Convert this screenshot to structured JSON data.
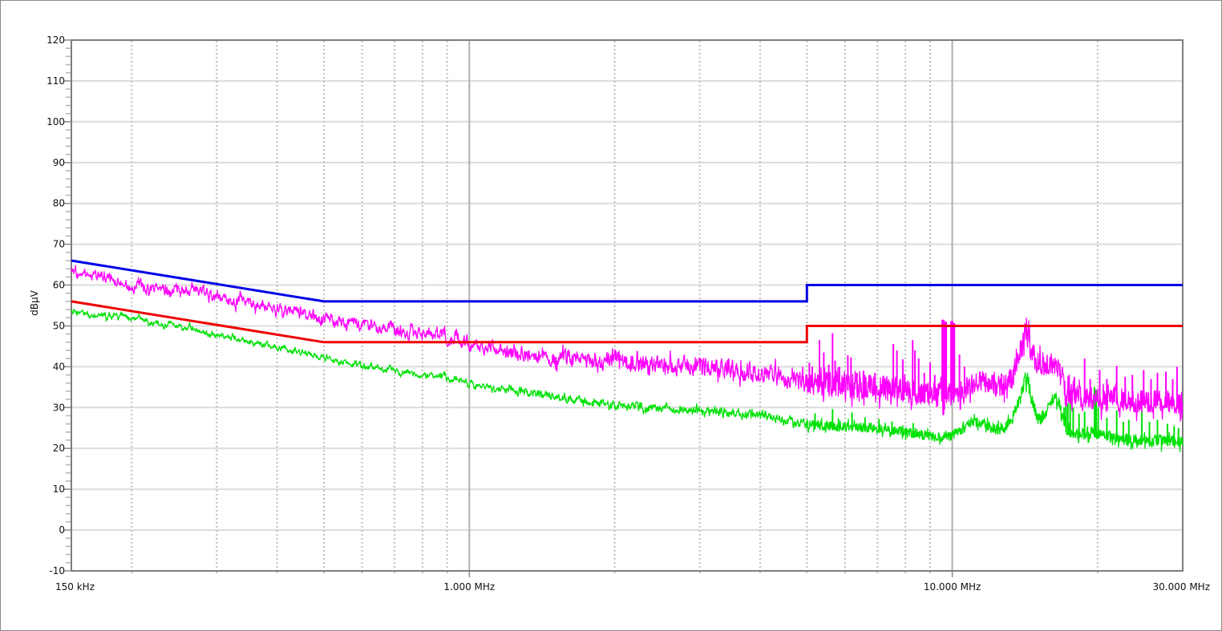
{
  "window": {
    "background": "#ffffff",
    "border_color": "#8c8c8c"
  },
  "chart_data": {
    "type": "line",
    "title": "",
    "plot": {
      "frame_color": "#7d7d7d",
      "h_grid_color": "#dcdcdc",
      "v_major_grid_color": "#b0b0b0",
      "v_minor_grid_color": "#bdbdbd",
      "tick_color": "#8a8a8a",
      "minor_tick_color": "#b8b8b8"
    },
    "y_axis": {
      "label": "dBµV",
      "min": -10,
      "max": 120,
      "major_step": 10,
      "minor_step": 2,
      "tick_labels": [
        "120",
        "110",
        "100",
        "90",
        "80",
        "70",
        "60",
        "50",
        "40",
        "30",
        "20",
        "10",
        "0",
        "-10"
      ]
    },
    "x_axis": {
      "scale": "log",
      "unit": "MHz",
      "min_mhz": 0.15,
      "max_mhz": 30,
      "ticks": [
        {
          "f": 0.15,
          "label": "150 kHz"
        },
        {
          "f": 1,
          "label": "1.000 MHz"
        },
        {
          "f": 10,
          "label": "10.000 MHz"
        },
        {
          "f": 30,
          "label": "30.000 MHz"
        }
      ],
      "minor_gridlines_mhz": [
        0.2,
        0.3,
        0.4,
        0.5,
        0.6,
        0.7,
        0.8,
        0.9,
        2,
        3,
        4,
        5,
        6,
        7,
        8,
        9,
        20
      ]
    },
    "series": [
      {
        "name": "trace-green-average",
        "color": "#00e106",
        "type": "noisy",
        "width": 1.3,
        "anchors": [
          [
            0.15,
            53.4
          ],
          [
            0.162,
            52.7
          ],
          [
            0.178,
            52.2
          ],
          [
            0.19,
            52.3
          ],
          [
            0.2,
            51.8
          ],
          [
            0.215,
            51.2
          ],
          [
            0.235,
            50.4
          ],
          [
            0.255,
            49.7
          ],
          [
            0.28,
            48.7
          ],
          [
            0.31,
            47.5
          ],
          [
            0.34,
            46.3
          ],
          [
            0.37,
            45.4
          ],
          [
            0.4,
            44.7
          ],
          [
            0.44,
            43.7
          ],
          [
            0.48,
            42.7
          ],
          [
            0.52,
            41.9
          ],
          [
            0.57,
            40.9
          ],
          [
            0.62,
            40.0
          ],
          [
            0.68,
            39.3
          ],
          [
            0.74,
            38.7
          ],
          [
            0.8,
            37.8
          ],
          [
            0.85,
            37.3
          ],
          [
            0.88,
            37.8
          ],
          [
            0.92,
            36.9
          ],
          [
            1.0,
            35.9
          ],
          [
            1.1,
            34.9
          ],
          [
            1.25,
            34.0
          ],
          [
            1.4,
            33.2
          ],
          [
            1.6,
            32.2
          ],
          [
            1.8,
            31.2
          ],
          [
            2.0,
            30.6
          ],
          [
            2.3,
            30.0
          ],
          [
            2.7,
            29.5
          ],
          [
            3.1,
            29.1
          ],
          [
            3.6,
            28.6
          ],
          [
            4.0,
            28.2
          ],
          [
            4.3,
            27.6
          ],
          [
            4.7,
            26.4
          ],
          [
            5.0,
            25.9
          ],
          [
            5.5,
            25.5
          ],
          [
            6.0,
            25.3
          ],
          [
            6.6,
            25.1
          ],
          [
            7.2,
            24.8
          ],
          [
            7.8,
            24.2
          ],
          [
            8.4,
            23.5
          ],
          [
            9.0,
            23.0
          ],
          [
            9.5,
            22.8
          ],
          [
            10.0,
            23.4
          ],
          [
            10.5,
            24.9
          ],
          [
            11.0,
            26.3
          ],
          [
            11.3,
            26.6
          ],
          [
            11.7,
            25.9
          ],
          [
            12.1,
            25.0
          ],
          [
            12.5,
            24.7
          ],
          [
            12.9,
            25.4
          ],
          [
            13.3,
            27.3
          ],
          [
            13.7,
            30.8
          ],
          [
            14.0,
            35.0
          ],
          [
            14.15,
            37.3
          ],
          [
            14.35,
            35.9
          ],
          [
            14.6,
            32.2
          ],
          [
            14.9,
            28.7
          ],
          [
            15.2,
            27.3
          ],
          [
            15.6,
            28.5
          ],
          [
            16.0,
            31.2
          ],
          [
            16.3,
            32.7
          ],
          [
            16.6,
            31.3
          ],
          [
            16.9,
            28.2
          ],
          [
            17.2,
            25.0
          ],
          [
            17.6,
            23.7
          ],
          [
            18.2,
            23.4
          ],
          [
            18.9,
            24.0
          ],
          [
            19.6,
            23.8
          ],
          [
            20.5,
            23.1
          ],
          [
            21.5,
            22.7
          ],
          [
            23,
            22.3
          ],
          [
            25,
            22.0
          ],
          [
            27,
            21.8
          ],
          [
            29,
            21.6
          ],
          [
            30,
            21.5
          ]
        ],
        "band": [
          [
            0.15,
            0.9
          ],
          [
            1,
            1.0
          ],
          [
            3,
            1.1
          ],
          [
            4.8,
            1.2
          ],
          [
            9,
            1.2
          ],
          [
            11,
            1.3
          ],
          [
            13,
            1.4
          ],
          [
            14.1,
            1.8
          ],
          [
            16,
            1.5
          ],
          [
            17.5,
            1.5
          ],
          [
            30,
            1.5
          ]
        ],
        "spikes": [
          [
            5.2,
            28.6
          ],
          [
            5.65,
            29.6
          ],
          [
            6.2,
            28.8
          ],
          [
            6.6,
            27.6
          ],
          [
            7.05,
            27.2
          ],
          [
            7.5,
            26.6
          ],
          [
            8.3,
            26.2
          ],
          [
            17.05,
            30
          ],
          [
            17.2,
            32
          ],
          [
            17.35,
            31
          ],
          [
            17.55,
            32.5
          ],
          [
            17.8,
            30
          ],
          [
            18.3,
            28.5
          ],
          [
            18.8,
            29
          ],
          [
            19.7,
            35
          ],
          [
            19.85,
            34.3
          ],
          [
            20.05,
            30
          ],
          [
            20.9,
            27.5
          ],
          [
            21.9,
            29.3
          ],
          [
            22.6,
            26.5
          ],
          [
            23.2,
            27
          ],
          [
            24.7,
            29.4
          ],
          [
            25.6,
            26.5
          ],
          [
            26.6,
            27
          ],
          [
            27.9,
            26
          ],
          [
            28.8,
            25.5
          ],
          [
            29.4,
            25
          ]
        ]
      },
      {
        "name": "trace-magenta-peak",
        "color": "#ff00ff",
        "type": "noisy",
        "width": 1.3,
        "anchors": [
          [
            0.15,
            63.2
          ],
          [
            0.158,
            62.5
          ],
          [
            0.167,
            62.0
          ],
          [
            0.178,
            61.5
          ],
          [
            0.19,
            61.0
          ],
          [
            0.2,
            60.3
          ],
          [
            0.213,
            59.8
          ],
          [
            0.228,
            59.2
          ],
          [
            0.243,
            58.7
          ],
          [
            0.26,
            58.9
          ],
          [
            0.275,
            58.1
          ],
          [
            0.29,
            57.5
          ],
          [
            0.31,
            56.9
          ],
          [
            0.33,
            56.3
          ],
          [
            0.35,
            55.7
          ],
          [
            0.375,
            55.2
          ],
          [
            0.4,
            54.6
          ],
          [
            0.43,
            53.9
          ],
          [
            0.46,
            52.9
          ],
          [
            0.5,
            51.9
          ],
          [
            0.54,
            51.1
          ],
          [
            0.58,
            50.5
          ],
          [
            0.63,
            49.9
          ],
          [
            0.68,
            49.4
          ],
          [
            0.73,
            48.8
          ],
          [
            0.79,
            48.1
          ],
          [
            0.85,
            47.4
          ],
          [
            0.92,
            46.9
          ],
          [
            1.0,
            46.3
          ],
          [
            1.06,
            45.4
          ],
          [
            1.15,
            44.0
          ],
          [
            1.3,
            43.1
          ],
          [
            1.5,
            42.3
          ],
          [
            1.7,
            41.8
          ],
          [
            2.0,
            41.2
          ],
          [
            2.4,
            40.7
          ],
          [
            2.8,
            40.3
          ],
          [
            3.2,
            39.7
          ],
          [
            3.6,
            39.1
          ],
          [
            4.0,
            38.4
          ],
          [
            4.4,
            37.5
          ],
          [
            4.8,
            36.7
          ],
          [
            5.2,
            35.9
          ],
          [
            5.7,
            35.4
          ],
          [
            6.2,
            35.1
          ],
          [
            6.8,
            34.9
          ],
          [
            7.4,
            34.6
          ],
          [
            8.0,
            34.1
          ],
          [
            8.6,
            33.6
          ],
          [
            9.1,
            33.2
          ],
          [
            9.5,
            33.0
          ],
          [
            10.0,
            33.3
          ],
          [
            10.4,
            33.9
          ],
          [
            10.8,
            35.0
          ],
          [
            11.2,
            36.6
          ],
          [
            11.5,
            36.7
          ],
          [
            11.9,
            35.8
          ],
          [
            12.3,
            35.1
          ],
          [
            12.7,
            35.3
          ],
          [
            13.1,
            36.5
          ],
          [
            13.45,
            38.5
          ],
          [
            13.75,
            42.0
          ],
          [
            14.0,
            46.5
          ],
          [
            14.15,
            48.8
          ],
          [
            14.35,
            47.8
          ],
          [
            14.6,
            45.0
          ],
          [
            14.85,
            42.0
          ],
          [
            15.15,
            39.8
          ],
          [
            15.5,
            39.6
          ],
          [
            15.9,
            40.4
          ],
          [
            16.25,
            41.0
          ],
          [
            16.55,
            39.8
          ],
          [
            16.85,
            37.2
          ],
          [
            17.2,
            34.6
          ],
          [
            17.6,
            33.1
          ],
          [
            18.1,
            32.6
          ],
          [
            18.8,
            32.3
          ],
          [
            19.8,
            32.1
          ],
          [
            21,
            31.9
          ],
          [
            23,
            31.7
          ],
          [
            25,
            31.5
          ],
          [
            27,
            31.4
          ],
          [
            30,
            31.2
          ]
        ],
        "band": [
          [
            0.15,
            1.6
          ],
          [
            0.5,
            1.8
          ],
          [
            1,
            2.0
          ],
          [
            2,
            2.2
          ],
          [
            4,
            2.4
          ],
          [
            5,
            2.8
          ],
          [
            7,
            3.0
          ],
          [
            9.5,
            3.2
          ],
          [
            10.5,
            2.6
          ],
          [
            13,
            2.6
          ],
          [
            14.1,
            3.6
          ],
          [
            15.2,
            3.2
          ],
          [
            16.3,
            2.8
          ],
          [
            17.5,
            2.8
          ],
          [
            30,
            2.8
          ]
        ],
        "spikes": [
          [
            5.06,
            41
          ],
          [
            5.13,
            40
          ],
          [
            5.31,
            46.5
          ],
          [
            5.42,
            43.5
          ],
          [
            5.55,
            40.5
          ],
          [
            5.65,
            48.2
          ],
          [
            5.72,
            41.5
          ],
          [
            5.84,
            40
          ],
          [
            6.08,
            42.8
          ],
          [
            6.17,
            42.3
          ],
          [
            6.35,
            38.5
          ],
          [
            6.55,
            39
          ],
          [
            6.75,
            38
          ],
          [
            6.92,
            38.5
          ],
          [
            7.2,
            37.8
          ],
          [
            7.55,
            45.6
          ],
          [
            7.68,
            44
          ],
          [
            7.9,
            41.8
          ],
          [
            8.28,
            46.5
          ],
          [
            8.37,
            44
          ],
          [
            8.52,
            42
          ],
          [
            8.75,
            38.5
          ],
          [
            9.0,
            41
          ],
          [
            9.2,
            38
          ],
          [
            9.57,
            51.5,
            4
          ],
          [
            9.68,
            51,
            4
          ],
          [
            9.98,
            51.2,
            4
          ],
          [
            10.08,
            50.7,
            3
          ],
          [
            10.35,
            43
          ],
          [
            10.6,
            40
          ],
          [
            12.15,
            38
          ],
          [
            12.65,
            38.3
          ],
          [
            17.45,
            38
          ],
          [
            17.9,
            37.5
          ],
          [
            18.8,
            42
          ],
          [
            19.3,
            37
          ],
          [
            20.2,
            39.2
          ],
          [
            20.9,
            37
          ],
          [
            21.9,
            40.2
          ],
          [
            22.8,
            37.5
          ],
          [
            23.6,
            38
          ],
          [
            24.9,
            39.2
          ],
          [
            25.8,
            37
          ],
          [
            26.6,
            38.5
          ],
          [
            27.7,
            38.8
          ],
          [
            28.6,
            37
          ],
          [
            29.2,
            40
          ]
        ]
      },
      {
        "name": "limit-red-average",
        "color": "#ef0000",
        "type": "step",
        "width": 3,
        "points": [
          [
            0.15,
            56
          ],
          [
            0.5,
            46
          ],
          [
            5,
            46
          ],
          [
            5,
            50
          ],
          [
            30,
            50
          ]
        ]
      },
      {
        "name": "limit-blue-quasi-peak",
        "color": "#0000e8",
        "type": "step",
        "width": 3,
        "points": [
          [
            0.15,
            66
          ],
          [
            0.5,
            56
          ],
          [
            5,
            56
          ],
          [
            5,
            60
          ],
          [
            30,
            60
          ]
        ]
      }
    ]
  }
}
